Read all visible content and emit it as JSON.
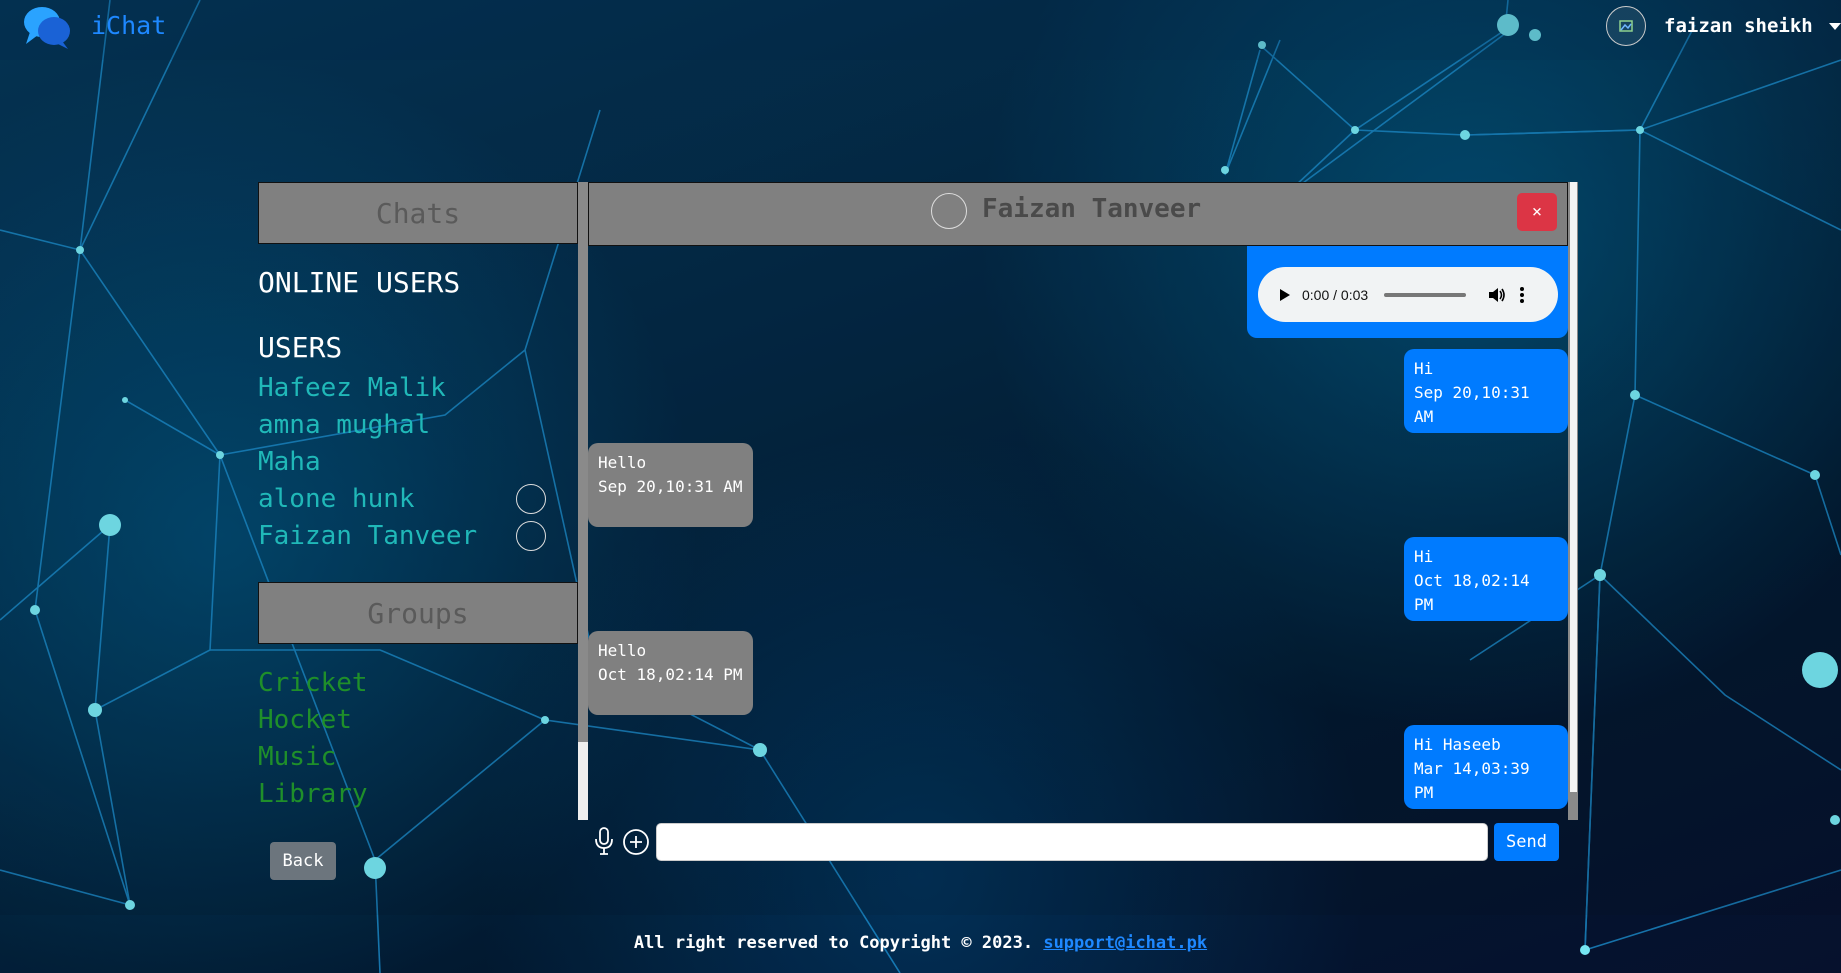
{
  "brand": {
    "name": "iChat",
    "logo_icon": "chat-bubbles-icon"
  },
  "navbar": {
    "username": "faizan sheikh"
  },
  "sidebar": {
    "chats_title": "Chats",
    "online_users_title": "ONLINE USERS",
    "users_title": "USERS",
    "users": [
      {
        "name": "Hafeez Malik",
        "has_avatar": false
      },
      {
        "name": "amna mughal",
        "has_avatar": false
      },
      {
        "name": "Maha",
        "has_avatar": false
      },
      {
        "name": "alone hunk",
        "has_avatar": true
      },
      {
        "name": "Faizan Tanveer",
        "has_avatar": true
      }
    ],
    "groups_title": "Groups",
    "groups": [
      "Cricket",
      "Hocket",
      "Music",
      "Library"
    ],
    "back_label": "Back"
  },
  "chat": {
    "contact_name": "Faizan Tanveer",
    "close_label": "×",
    "audio": {
      "time": "0:00 / 0:03"
    },
    "messages": [
      {
        "direction": "sent",
        "text": "Hi",
        "time": "Sep 20,10:31 AM"
      },
      {
        "direction": "received",
        "text": "Hello",
        "time": "Sep 20,10:31 AM"
      },
      {
        "direction": "sent",
        "text": "Hi",
        "time": "Oct 18,02:14 PM"
      },
      {
        "direction": "received",
        "text": "Hello",
        "time": "Oct 18,02:14 PM"
      },
      {
        "direction": "sent",
        "text": "Hi Haseeb",
        "time": "Mar 14,03:39 PM"
      }
    ]
  },
  "composer": {
    "placeholder": "",
    "send_label": "Send",
    "mic_icon": "microphone-icon",
    "attach_icon": "plus-circle-icon"
  },
  "footer": {
    "text": "All right reserved to Copyright © 2023.",
    "email": "support@ichat.pk"
  },
  "colors": {
    "accent": "#007bff",
    "brand": "#1e88ff",
    "close": "#dc3545",
    "panel": "#808080",
    "user_link": "#20b8b8",
    "group_link": "#1f8f2a"
  }
}
